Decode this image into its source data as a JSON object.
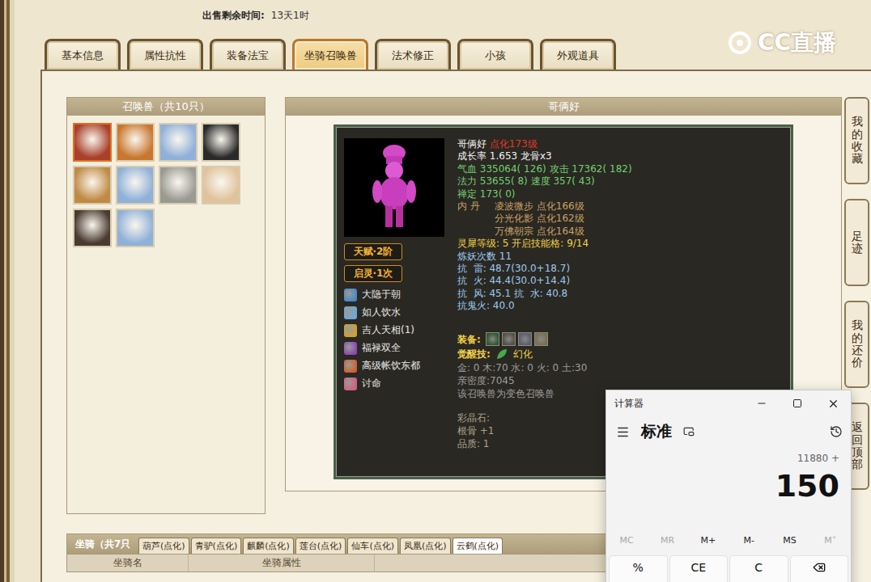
{
  "sale_time": {
    "label": "出售剩余时间:",
    "value": "13天1时"
  },
  "logo": "CC直播",
  "tabs": [
    {
      "label": "基本信息",
      "selected": false
    },
    {
      "label": "属性抗性",
      "selected": false
    },
    {
      "label": "装备法宝",
      "selected": false
    },
    {
      "label": "坐骑召唤兽",
      "selected": true
    },
    {
      "label": "法术修正",
      "selected": false
    },
    {
      "label": "小孩",
      "selected": false
    },
    {
      "label": "外观道具",
      "selected": false
    }
  ],
  "pet_list": {
    "title": "召唤兽（共10只）",
    "pets": [
      {
        "selected": true,
        "color": "#a8402a"
      },
      {
        "selected": false,
        "color": "#c9772f"
      },
      {
        "selected": false,
        "color": "#8fb0d8"
      },
      {
        "selected": false,
        "color": "#2a2a2a"
      },
      {
        "selected": false,
        "color": "#c08a45"
      },
      {
        "selected": false,
        "color": "#8fb0d8"
      },
      {
        "selected": false,
        "color": "#9a9a92"
      },
      {
        "selected": false,
        "color": "#e0c29c"
      },
      {
        "selected": false,
        "color": "#4a3a30"
      },
      {
        "selected": false,
        "color": "#8fb0d8"
      }
    ]
  },
  "pet": {
    "title": "哥俩好",
    "badges": [
      "天赋·2阶",
      "启灵·1次"
    ],
    "skills": [
      {
        "name": "大隐于朝",
        "color": "#4a88c8"
      },
      {
        "name": "如人饮水",
        "color": "#6aa8d8"
      },
      {
        "name": "吉人天相(1)",
        "color": "#d0a030"
      },
      {
        "name": "福禄双全",
        "color": "#8a4ab0"
      },
      {
        "name": "高级帐饮东都",
        "color": "#d06030"
      },
      {
        "name": "讨命",
        "color": "#d06080"
      }
    ],
    "stats": [
      [
        {
          "text": "哥俩好 ",
          "color": "#f2f2f2"
        },
        {
          "text": "点化173级",
          "color": "#e03a2a"
        }
      ],
      [
        {
          "text": "成长率 1.653 龙骨x3",
          "color": "#f2f2f2"
        }
      ],
      [
        {
          "text": "气血 335064( 126) 攻击 17362( 182)",
          "color": "#72cf72"
        }
      ],
      [
        {
          "text": "法力 53655( 8) 速度 357( 43)",
          "color": "#72cf72"
        }
      ],
      [
        {
          "text": "禅定 173( 0)",
          "color": "#72cf72"
        }
      ]
    ],
    "neidan": {
      "label": "内 丹",
      "items": [
        "凌波微步 点化166级",
        "分光化影 点化162级",
        "万佛朝宗 点化164级"
      ]
    },
    "resist": [
      [
        {
          "text": "灵犀等级: 5 开启技能格: 9/14",
          "color": "#f0d048"
        }
      ],
      [
        {
          "text": "炼妖次数 11",
          "color": "#9ccaf2"
        }
      ],
      [
        {
          "text": "抗  雷: 48.7(30.0+18.7)",
          "color": "#9ccaf2"
        }
      ],
      [
        {
          "text": "抗  火: 44.4(30.0+14.4)",
          "color": "#9ccaf2"
        }
      ],
      [
        {
          "text": "抗  风: 45.1 抗  水: 40.8",
          "color": "#9ccaf2"
        }
      ],
      [
        {
          "text": "抗鬼火: 40.0",
          "color": "#9ccaf2"
        }
      ]
    ],
    "equipment": {
      "label": "装备:",
      "items": [
        {
          "color": "#2f5a32"
        },
        {
          "color": "#55504a"
        },
        {
          "color": "#5e5e70"
        },
        {
          "color": "#7a6e56"
        }
      ]
    },
    "awaken": {
      "label": "觉醒技:",
      "name": "幻化",
      "color": "#4aa84a"
    },
    "notes": [
      [
        {
          "text": "金: 0 木:70 水: 0 火: 0 土:30",
          "color": "#9c9c9c"
        }
      ],
      [
        {
          "text": "亲密度:7045",
          "color": "#9c9c9c"
        }
      ],
      [
        {
          "text": "该召唤兽为变色召唤兽",
          "color": "#9c9c9c"
        }
      ]
    ],
    "gems": [
      [
        {
          "text": "彩晶石:",
          "color": "#aaa48e"
        }
      ],
      [
        {
          "text": "根骨 +1",
          "color": "#aaa48e"
        }
      ],
      [
        {
          "text": "品质: 1",
          "color": "#aaa48e"
        }
      ]
    ]
  },
  "side_buttons": [
    "我的收藏",
    "足迹",
    "我的还价",
    "返回顶部"
  ],
  "mounts": {
    "title": "坐骑（共7只",
    "tabs": [
      {
        "label": "葫芦(点化)",
        "selected": false
      },
      {
        "label": "青驴(点化)",
        "selected": false
      },
      {
        "label": "麒麟(点化)",
        "selected": false
      },
      {
        "label": "莲台(点化)",
        "selected": false
      },
      {
        "label": "仙车(点化)",
        "selected": false
      },
      {
        "label": "凤凰(点化)",
        "selected": false
      },
      {
        "label": "云鹤(点化)",
        "selected": true
      }
    ],
    "columns": [
      "坐骑名",
      "坐骑属性"
    ]
  },
  "calculator": {
    "title": "计算器",
    "mode": "标准",
    "history": "11880 +",
    "display": "150",
    "memory": [
      {
        "label": "MC",
        "disabled": true
      },
      {
        "label": "MR",
        "disabled": true
      },
      {
        "label": "M+",
        "disabled": false
      },
      {
        "label": "M-",
        "disabled": false
      },
      {
        "label": "MS",
        "disabled": false
      },
      {
        "label": "M˅",
        "disabled": true
      }
    ],
    "keys": [
      "%",
      "CE",
      "C"
    ]
  }
}
